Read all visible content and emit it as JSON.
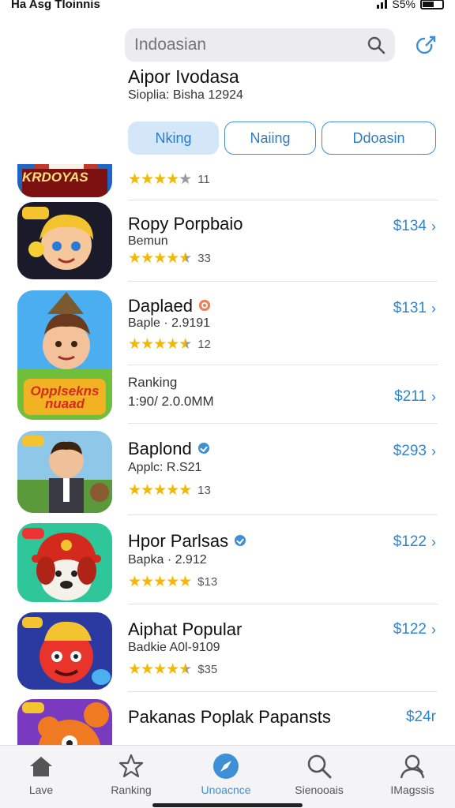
{
  "status_bar": {
    "carrier": "Ha Asg Tloinnis",
    "battery_text": "S5%"
  },
  "header": {
    "search_placeholder": "Indoasian",
    "title": "Aipor Ivodasa",
    "subtitle": "Sioplia: Bisha 12924",
    "pills": [
      "Nking",
      "Naiing",
      "Ddoasin"
    ],
    "active_pill": 0
  },
  "apps": [
    {
      "icon_text": "KRDOYAS",
      "rating": 4,
      "rating_count": "11"
    },
    {
      "title": "Ropy Porpbaio",
      "subtitle": "Bemun",
      "rating": 4.5,
      "rating_count": "33",
      "price": "$134",
      "icon": "blonde-kid-icon"
    },
    {
      "title": "Daplaed",
      "subtitle": "Baple · 2.9191",
      "rating": 4.5,
      "rating_count": "12",
      "price": "$131",
      "badge": "orange",
      "icon_text": "Opplsekns nuaad"
    },
    {
      "title": "Ranking",
      "subtitle": "1:90/ 2.0.0MM",
      "price": "$211"
    },
    {
      "title": "Baplond",
      "subtitle": "Applc: R.S21",
      "rating": 5,
      "rating_count": "13",
      "price": "$293",
      "badge": "blue",
      "icon": "businessman-icon"
    },
    {
      "title": "Hpor Parlsas",
      "subtitle": "Bapka · 2.912",
      "rating": 5,
      "rating_count": "$13",
      "price": "$122",
      "badge": "blue",
      "icon": "dog-firefighter-icon"
    },
    {
      "title": "Aiphat Popular",
      "subtitle": "Badkie A0l-9109",
      "rating": 4.5,
      "rating_count": "$35",
      "price": "$122",
      "icon": "red-monster-icon"
    },
    {
      "title": "Pakanas Poplak Papansts",
      "price": "$24r",
      "icon": "orange-bear-icon"
    }
  ],
  "tabs": [
    {
      "label": "Lave",
      "icon": "home-icon"
    },
    {
      "label": "Ranking",
      "icon": "star-icon"
    },
    {
      "label": "Unoacnce",
      "icon": "compass-icon",
      "active": true
    },
    {
      "label": "Sienooais",
      "icon": "search-icon"
    },
    {
      "label": "IMagssis",
      "icon": "profile-icon"
    }
  ],
  "colors": {
    "accent": "#3d8fd6",
    "star": "#f5b800",
    "price": "#2f86d0",
    "tab_bar": "#f4f4f6"
  }
}
